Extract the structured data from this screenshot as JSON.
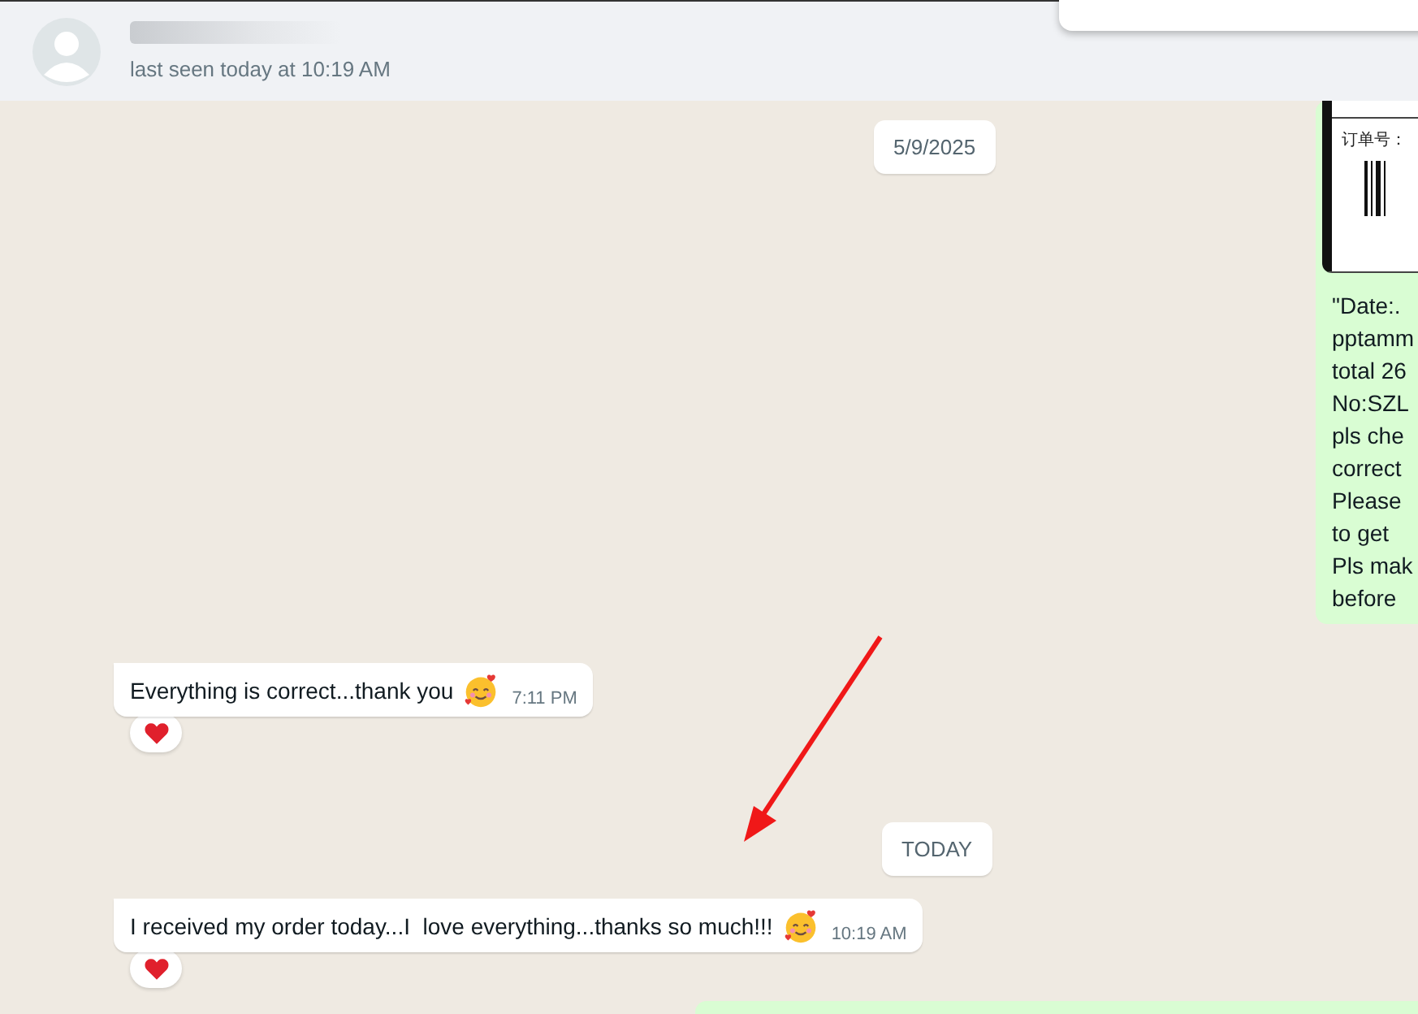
{
  "header": {
    "status": "last seen today at 10:19 AM"
  },
  "outgoing": {
    "receipt_label": "订单号：",
    "lines": [
      "\"Date:.",
      "pptamm",
      "total 26",
      "No:SZL",
      "pls che",
      "correct",
      "Please",
      "to get",
      "Pls mak",
      "before"
    ]
  },
  "messages": [
    {
      "kind": "date",
      "text": "5/9/2025"
    },
    {
      "kind": "incoming",
      "text": "Everything is correct...thank you",
      "time": "7:11 PM",
      "reaction": true
    },
    {
      "kind": "date",
      "text": "TODAY"
    },
    {
      "kind": "incoming",
      "text": "I received my order today...I  love everything...thanks so much!!!",
      "time": "10:19 AM",
      "reaction": true
    }
  ]
}
